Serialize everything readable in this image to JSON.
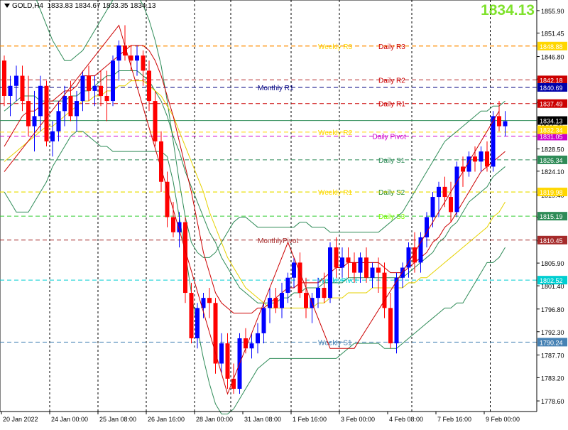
{
  "header": {
    "symbol": "GOLD,H4",
    "ohlc": "1833.83 1834.67 1833.35 1834.13"
  },
  "big_price": "1834.13",
  "chart_data": {
    "type": "candlestick",
    "ylim": [
      1776.5,
      1858.0
    ],
    "y_ticks": [
      "1855.90",
      "1851.45",
      "1846.80",
      "1842.35",
      "1837.70",
      "1833.20",
      "1828.50",
      "1824.10",
      "1819.40",
      "1815.00",
      "1810.30",
      "1805.90",
      "1801.40",
      "1796.80",
      "1792.30",
      "1787.70",
      "1783.20",
      "1778.60"
    ],
    "x_ticks": [
      {
        "i": 0,
        "label": "20 Jan 2022"
      },
      {
        "i": 8,
        "label": "24 Jan 00:00"
      },
      {
        "i": 16,
        "label": "25 Jan 08:00"
      },
      {
        "i": 24,
        "label": "26 Jan 16:00"
      },
      {
        "i": 32,
        "label": "28 Jan 00:00"
      },
      {
        "i": 40,
        "label": "31 Jan 08:00"
      },
      {
        "i": 48,
        "label": "1 Feb 16:00"
      },
      {
        "i": 56,
        "label": "3 Feb 00:00"
      },
      {
        "i": 64,
        "label": "4 Feb 08:00"
      },
      {
        "i": 72,
        "label": "7 Feb 16:00"
      },
      {
        "i": 80,
        "label": "9 Feb 00:00"
      }
    ],
    "period_separators": [
      8,
      16,
      24,
      32,
      38,
      48,
      56,
      68,
      81
    ],
    "up_color": "#0000ff",
    "down_color": "#ff0000",
    "candles": [
      [
        1846,
        1847,
        1837,
        1839
      ],
      [
        1839,
        1843,
        1835,
        1841
      ],
      [
        1841,
        1845,
        1838,
        1843
      ],
      [
        1843,
        1845,
        1836,
        1838
      ],
      [
        1838,
        1843,
        1831,
        1833
      ],
      [
        1833,
        1840,
        1828,
        1835
      ],
      [
        1835,
        1843,
        1832,
        1841
      ],
      [
        1841,
        1842,
        1829,
        1830
      ],
      [
        1830,
        1834,
        1827,
        1832
      ],
      [
        1832,
        1838,
        1830,
        1836
      ],
      [
        1836,
        1841,
        1833,
        1839
      ],
      [
        1839,
        1842,
        1834,
        1835
      ],
      [
        1835,
        1840,
        1832,
        1838
      ],
      [
        1838,
        1844,
        1836,
        1843
      ],
      [
        1843,
        1845,
        1838,
        1840
      ],
      [
        1840,
        1843,
        1837,
        1841
      ],
      [
        1841,
        1844,
        1837,
        1839
      ],
      [
        1839,
        1844,
        1834,
        1838
      ],
      [
        1838,
        1847,
        1837,
        1846
      ],
      [
        1846,
        1850,
        1842,
        1849
      ],
      [
        1849,
        1853,
        1846,
        1847
      ],
      [
        1847,
        1849,
        1844,
        1846
      ],
      [
        1846,
        1849,
        1843,
        1847
      ],
      [
        1847,
        1848,
        1841,
        1844
      ],
      [
        1844,
        1846,
        1836,
        1838
      ],
      [
        1838,
        1840,
        1829,
        1830
      ],
      [
        1830,
        1832,
        1820,
        1822
      ],
      [
        1822,
        1824,
        1813,
        1815
      ],
      [
        1815,
        1818,
        1811,
        1812
      ],
      [
        1812,
        1816,
        1809,
        1814
      ],
      [
        1814,
        1815,
        1798,
        1800
      ],
      [
        1800,
        1802,
        1790,
        1791
      ],
      [
        1791,
        1798,
        1789,
        1797
      ],
      [
        1797,
        1800,
        1795,
        1799
      ],
      [
        1799,
        1801,
        1795,
        1798
      ],
      [
        1798,
        1799,
        1784,
        1786
      ],
      [
        1786,
        1792,
        1784,
        1790
      ],
      [
        1790,
        1792,
        1781,
        1783
      ],
      [
        1783,
        1786,
        1780,
        1781
      ],
      [
        1781,
        1792,
        1780,
        1791
      ],
      [
        1791,
        1793,
        1788,
        1789
      ],
      [
        1789,
        1792,
        1787,
        1790
      ],
      [
        1790,
        1794,
        1788,
        1792
      ],
      [
        1792,
        1798,
        1790,
        1797
      ],
      [
        1797,
        1801,
        1794,
        1799
      ],
      [
        1799,
        1801,
        1796,
        1797
      ],
      [
        1797,
        1802,
        1795,
        1800
      ],
      [
        1800,
        1804,
        1798,
        1803
      ],
      [
        1803,
        1807,
        1801,
        1806
      ],
      [
        1806,
        1808,
        1799,
        1800
      ],
      [
        1800,
        1803,
        1795,
        1797
      ],
      [
        1797,
        1800,
        1794,
        1799
      ],
      [
        1799,
        1803,
        1797,
        1801
      ],
      [
        1801,
        1804,
        1798,
        1799
      ],
      [
        1799,
        1810,
        1798,
        1809
      ],
      [
        1809,
        1811,
        1803,
        1805
      ],
      [
        1805,
        1809,
        1803,
        1807
      ],
      [
        1807,
        1809,
        1803,
        1806
      ],
      [
        1806,
        1808,
        1802,
        1804
      ],
      [
        1804,
        1808,
        1802,
        1807
      ],
      [
        1807,
        1809,
        1802,
        1803
      ],
      [
        1803,
        1806,
        1801,
        1805
      ],
      [
        1805,
        1807,
        1800,
        1804
      ],
      [
        1804,
        1806,
        1795,
        1797
      ],
      [
        1797,
        1800,
        1789,
        1790
      ],
      [
        1790,
        1804,
        1788,
        1803
      ],
      [
        1803,
        1806,
        1801,
        1805
      ],
      [
        1805,
        1810,
        1803,
        1809
      ],
      [
        1809,
        1812,
        1804,
        1806
      ],
      [
        1806,
        1812,
        1804,
        1811
      ],
      [
        1811,
        1816,
        1809,
        1815
      ],
      [
        1815,
        1820,
        1813,
        1819
      ],
      [
        1819,
        1822,
        1815,
        1821
      ],
      [
        1821,
        1823,
        1817,
        1819
      ],
      [
        1819,
        1822,
        1814,
        1816
      ],
      [
        1816,
        1826,
        1815,
        1825
      ],
      [
        1825,
        1827,
        1821,
        1824
      ],
      [
        1824,
        1828,
        1823,
        1827
      ],
      [
        1827,
        1829,
        1824,
        1826
      ],
      [
        1826,
        1829,
        1824,
        1828
      ],
      [
        1828,
        1830,
        1824,
        1825
      ],
      [
        1825,
        1836,
        1824,
        1835
      ],
      [
        1835,
        1838,
        1832,
        1833
      ],
      [
        1833,
        1836,
        1831,
        1834
      ]
    ],
    "levels": [
      {
        "name": "Weekly R3",
        "price": 1848.88,
        "color": "#ff8c00",
        "label": "1848.88",
        "label_bg": "#ffd700",
        "text": "Weekly R3",
        "text_color": "#ffd700",
        "text_i": 52
      },
      {
        "name": "Daily R3",
        "price": 1848.88,
        "color": "#ff8c00",
        "text": "Daily R3",
        "text_color": "#cc0000",
        "text_i": 62,
        "label": "",
        "label_bg": ""
      },
      {
        "name": "Daily R2",
        "price": 1842.18,
        "color": "#b22222",
        "label": "1842.18",
        "label_bg": "#cc0000",
        "text": "Daily R2",
        "text_color": "#cc0000",
        "text_i": 62
      },
      {
        "name": "Monthly R1",
        "price": 1840.69,
        "color": "#000080",
        "label": "1840.69",
        "label_bg": "#0000aa",
        "text": "Monthly R1",
        "text_color": "#000080",
        "text_i": 42
      },
      {
        "name": "Daily R1",
        "price": 1837.49,
        "color": "#cc0000",
        "label": "1837.49",
        "label_bg": "#cc0000",
        "text": "Daily R1",
        "text_color": "#cc0000",
        "text_i": 62
      },
      {
        "name": "Weekly R2",
        "price": 1831.83,
        "color": "#ffd700",
        "label": "",
        "label_bg": "",
        "text": "Weekly R2",
        "text_color": "#ffd700",
        "text_i": 52
      },
      {
        "name": "Daily Pivot",
        "price": 1831.05,
        "color": "#cc00cc",
        "label": "1831.05",
        "label_bg": "#cc00cc",
        "text": "Daily Pivot",
        "text_color": "#cc00cc",
        "text_i": 61
      },
      {
        "name": "Daily S1",
        "price": 1826.34,
        "color": "#2e8b57",
        "label": "1826.34",
        "label_bg": "#2e8b57",
        "text": "Daily S1",
        "text_color": "#2e8b57",
        "text_i": 62
      },
      {
        "name": "Daily S2",
        "price": 1819.98,
        "color": "#7cfc00",
        "label": "1819.98",
        "label_bg": "#ffd700",
        "text": "Daily S2",
        "text_color": "#228b22",
        "text_i": 62
      },
      {
        "name": "Weekly R1",
        "price": 1819.98,
        "color": "#ffd700",
        "label": "",
        "label_bg": "",
        "text": "Weekly R1",
        "text_color": "#ffd700",
        "text_i": 52
      },
      {
        "name": "Daily S3",
        "price": 1815.19,
        "color": "#32cd32",
        "label": "1815.19",
        "label_bg": "#2e8b57",
        "text": "Daily S3",
        "text_color": "#7cfc00",
        "text_i": 62
      },
      {
        "name": "MonthlyPivot",
        "price": 1810.45,
        "color": "#a52a2a",
        "label": "1810.45",
        "label_bg": "#a52a2a",
        "text": "MonthlyPivot",
        "text_color": "#a52a2a",
        "text_i": 42
      },
      {
        "name": "WeeklyPivot",
        "price": 1802.52,
        "color": "#00ced1",
        "label": "1802.52",
        "label_bg": "#00ced1",
        "text": "WeeklyPivot",
        "text_color": "#00ced1",
        "text_i": 52
      },
      {
        "name": "Weekly S1",
        "price": 1790.24,
        "color": "#4682b4",
        "label": "1790.24",
        "label_bg": "#4682b4",
        "text": "Weekly S1",
        "text_color": "#4682b4",
        "text_i": 52
      }
    ],
    "current_price": {
      "value": 1834.13,
      "label": "1834.13",
      "line_color": "#2e8b57"
    },
    "extra_price_labels": [
      {
        "value": 1833.2,
        "label": "1833.20",
        "bg": "#ffffff",
        "color": "#000"
      },
      {
        "value": 1832.3,
        "label": "1832.34",
        "bg": "#ffd700",
        "color": "#fff"
      }
    ],
    "bollinger": {
      "upper": [
        1858,
        1860,
        1861,
        1862,
        1861,
        1859,
        1856,
        1853,
        1850,
        1848,
        1846,
        1846,
        1847,
        1848,
        1850,
        1852,
        1854,
        1856,
        1858,
        1859,
        1860,
        1860,
        1859,
        1857,
        1854,
        1850,
        1845,
        1838,
        1830,
        1822,
        1815,
        1810,
        1808,
        1807,
        1807,
        1808,
        1810,
        1812,
        1814,
        1815,
        1815,
        1814,
        1813,
        1813,
        1813,
        1813,
        1813,
        1813,
        1813,
        1814,
        1814,
        1813,
        1813,
        1813,
        1812,
        1812,
        1812,
        1812,
        1812,
        1812,
        1812,
        1812,
        1812,
        1813,
        1814,
        1815,
        1816,
        1818,
        1820,
        1822,
        1824,
        1826,
        1828,
        1830,
        1831,
        1832,
        1833,
        1834,
        1835,
        1836,
        1836,
        1837,
        1837,
        1838
      ],
      "middle": [
        1836,
        1837,
        1838,
        1839,
        1839,
        1839,
        1838,
        1838,
        1838,
        1838,
        1838,
        1839,
        1839,
        1840,
        1840,
        1841,
        1842,
        1843,
        1843,
        1844,
        1844,
        1844,
        1844,
        1843,
        1842,
        1840,
        1838,
        1835,
        1831,
        1828,
        1824,
        1821,
        1818,
        1815,
        1812,
        1810,
        1807,
        1805,
        1803,
        1801,
        1800,
        1799,
        1798,
        1798,
        1798,
        1798,
        1799,
        1799,
        1800,
        1800,
        1801,
        1801,
        1801,
        1802,
        1802,
        1802,
        1802,
        1803,
        1803,
        1803,
        1803,
        1803,
        1803,
        1803,
        1803,
        1803,
        1803,
        1804,
        1805,
        1806,
        1807,
        1808,
        1810,
        1811,
        1813,
        1814,
        1816,
        1818,
        1819,
        1820,
        1821,
        1823,
        1824,
        1825
      ],
      "lower": [
        1820,
        1818,
        1816,
        1816,
        1816,
        1818,
        1820,
        1822,
        1825,
        1827,
        1829,
        1831,
        1832,
        1832,
        1831,
        1830,
        1829,
        1829,
        1828,
        1828,
        1828,
        1828,
        1828,
        1828,
        1828,
        1828,
        1828,
        1827,
        1822,
        1815,
        1808,
        1800,
        1793,
        1787,
        1782,
        1778,
        1776,
        1776,
        1777,
        1779,
        1781,
        1783,
        1785,
        1786,
        1787,
        1787,
        1787,
        1787,
        1787,
        1787,
        1787,
        1787,
        1787,
        1787,
        1787,
        1787,
        1788,
        1789,
        1790,
        1790,
        1790,
        1790,
        1790,
        1789,
        1789,
        1789,
        1790,
        1791,
        1792,
        1793,
        1794,
        1795,
        1796,
        1797,
        1797,
        1798,
        1798,
        1800,
        1802,
        1804,
        1806,
        1806,
        1807,
        1809
      ]
    },
    "ma_red": [
      1829,
      1831,
      1833,
      1835,
      1836,
      1836,
      1837,
      1838,
      1838,
      1839,
      1840,
      1840,
      1841,
      1843,
      1843,
      1843,
      1844,
      1845,
      1846,
      1847,
      1848,
      1849,
      1849,
      1849,
      1848,
      1846,
      1843,
      1839,
      1835,
      1830,
      1825,
      1820,
      1814,
      1808,
      1804,
      1800,
      1798,
      1797,
      1796,
      1796,
      1796,
      1796,
      1797,
      1797,
      1798,
      1799,
      1800,
      1801,
      1801,
      1802,
      1802,
      1802,
      1802,
      1803,
      1804,
      1805,
      1805,
      1806,
      1806,
      1806,
      1806,
      1806,
      1806,
      1805,
      1804,
      1804,
      1804,
      1805,
      1806,
      1807,
      1808,
      1810,
      1811,
      1813,
      1814,
      1816,
      1818,
      1820,
      1822,
      1824,
      1825,
      1826,
      1827,
      1828
    ],
    "ma_yellow": [
      1826,
      1827,
      1828,
      1829,
      1830,
      1831,
      1832,
      1833,
      1833,
      1834,
      1835,
      1836,
      1837,
      1838,
      1838,
      1839,
      1839,
      1840,
      1840,
      1841,
      1841,
      1842,
      1842,
      1842,
      1841,
      1840,
      1839,
      1837,
      1835,
      1832,
      1829,
      1826,
      1823,
      1820,
      1816,
      1813,
      1810,
      1807,
      1805,
      1803,
      1801,
      1800,
      1799,
      1798,
      1797,
      1797,
      1797,
      1797,
      1797,
      1797,
      1797,
      1797,
      1798,
      1798,
      1799,
      1799,
      1799,
      1800,
      1800,
      1800,
      1800,
      1801,
      1801,
      1801,
      1801,
      1801,
      1801,
      1802,
      1802,
      1803,
      1803,
      1804,
      1805,
      1806,
      1807,
      1808,
      1809,
      1810,
      1811,
      1812,
      1813,
      1815,
      1816,
      1818
    ],
    "zigzag": [
      [
        0,
        1824
      ],
      [
        19,
        1853
      ],
      [
        37,
        1780
      ],
      [
        47,
        1810
      ],
      [
        54,
        1789
      ],
      [
        58,
        1789
      ],
      [
        68,
        1808
      ],
      [
        70,
        1812
      ],
      [
        82,
        1836
      ]
    ]
  }
}
